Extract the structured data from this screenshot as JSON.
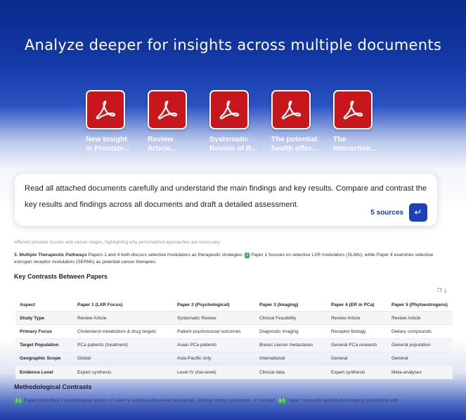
{
  "headline": "Analyze deeper for insights across multiple documents",
  "documents": [
    {
      "title_line1": "New Insight",
      "title_line2": "in Prostate..."
    },
    {
      "title_line1": "Review",
      "title_line2": "Article..."
    },
    {
      "title_line1": "Systematic",
      "title_line2": "Review of R..."
    },
    {
      "title_line1": "The potential",
      "title_line2": "health effec..."
    },
    {
      "title_line1": "The",
      "title_line2": "Interaction..."
    }
  ],
  "prompt": {
    "text": "Read all attached documents carefully and understand the main findings and key results. Compare and contrast the key results and findings across all documents and draft a detailed assessment.",
    "sources": "5 sources",
    "send_icon": "enter-arrow-icon"
  },
  "response": {
    "faded_line": "different prostate tissues and cancer stages, highlighting why personalized approaches are necessary.",
    "pathways_heading": "3. Multiple Therapeutic Pathways",
    "pathways_text_a": " Papers 1 and 4 both discuss selective modulators as therapeutic strategies. ",
    "pathways_cite": "2",
    "pathways_text_b": " Paper 1 focuses on selective LXR modulators (SLiMs), while Paper 4 examines selective estrogen receptor modulators (SERMs) as potential cancer therapies.",
    "key_contrasts_title": "Key Contrasts Between Papers",
    "table": {
      "headers": [
        "Aspect",
        "Paper 1 (LXR Focus)",
        "Paper 2 (Psychological)",
        "Paper 3 (Imaging)",
        "Paper 4 (ER in PCa)",
        "Paper 5 (Phytoestrogens)"
      ],
      "rows": [
        [
          "Study Type",
          "Review Article",
          "Systematic Review",
          "Clinical Feasibility",
          "Review Article",
          "Review Article"
        ],
        [
          "Primary Focus",
          "Cholesterol metabolism & drug targets",
          "Patient psychosocial outcomes",
          "Diagnostic imaging",
          "Receptor biology",
          "Dietary compounds"
        ],
        [
          "Target Population",
          "PCa patients (treatment)",
          "Asian PCa patients",
          "Breast cancer metastases",
          "General PCa research",
          "General population"
        ],
        [
          "Geographic Scope",
          "Global",
          "Asia-Pacific only",
          "International",
          "General",
          "General"
        ],
        [
          "Evidence Level",
          "Expert synthesis",
          "Level IV (low-level)",
          "Clinical data",
          "Expert synthesis",
          "Meta-analyses"
        ]
      ]
    },
    "methodological_title": "Methodological Contrasts",
    "method_cite_1": "2.1",
    "method_text_a": " Papers2identified 5 psychological studies of Level IV evidence (low-level descriptive), limiting strong conclusions. In contrast, ",
    "method_cite_2": "3.1",
    "method_text_b": " Paper 3 presents quantitative imaging correlations with"
  },
  "colors": {
    "accent": "#1e40b8",
    "pdf_red": "#c8161d",
    "cite_green": "#3aaa5c"
  }
}
